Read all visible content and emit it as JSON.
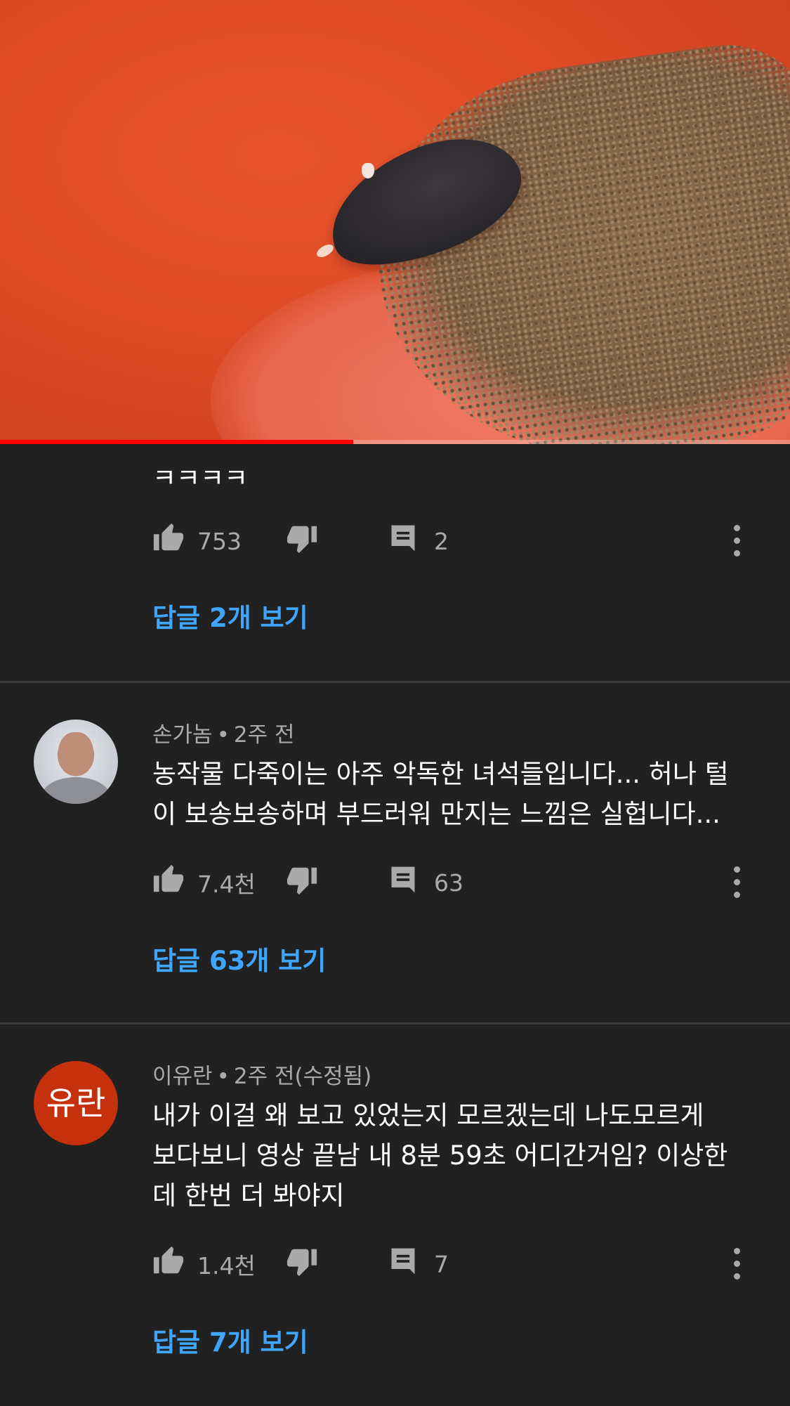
{
  "video": {
    "progress_fraction": 0.447,
    "colors": {
      "progress": "#ff0000",
      "track": "#5a5a5a"
    }
  },
  "comments": [
    {
      "author": "",
      "time": "",
      "text": "ㅋㅋㅋㅋ",
      "likes": "753",
      "replies": "2",
      "view_replies": "답글 2개 보기"
    },
    {
      "author": "손가놈",
      "time": "2주 전",
      "text_lines": [
        "농작물 다죽이는 아주 악독한 녀석들입니다... 허나 털",
        "이 보송보송하며 부드러워 만지는 느낌은 실헙니다..."
      ],
      "likes": "7.4천",
      "replies": "63",
      "view_replies": "답글 63개 보기"
    },
    {
      "author": "이유란",
      "avatar_text": "유란",
      "time": "2주 전(수정됨)",
      "text_lines": [
        "내가 이걸 왜 보고 있었는지 모르겠는데 나도모르게",
        "보다보니 영상 끝남 내 8분 59초 어디간거임? 이상한",
        "데 한번 더 봐야지"
      ],
      "likes": "1.4천",
      "replies": "7",
      "view_replies": "답글 7개 보기"
    }
  ],
  "icons": {
    "like": "thumbs-up-icon",
    "dislike": "thumbs-down-icon",
    "reply": "comment-icon",
    "more": "more-vertical-icon"
  },
  "colors": {
    "background": "#212121",
    "link": "#3ea6ff",
    "meta": "#aaaaaa",
    "avatar_bg": "#c5300d"
  }
}
